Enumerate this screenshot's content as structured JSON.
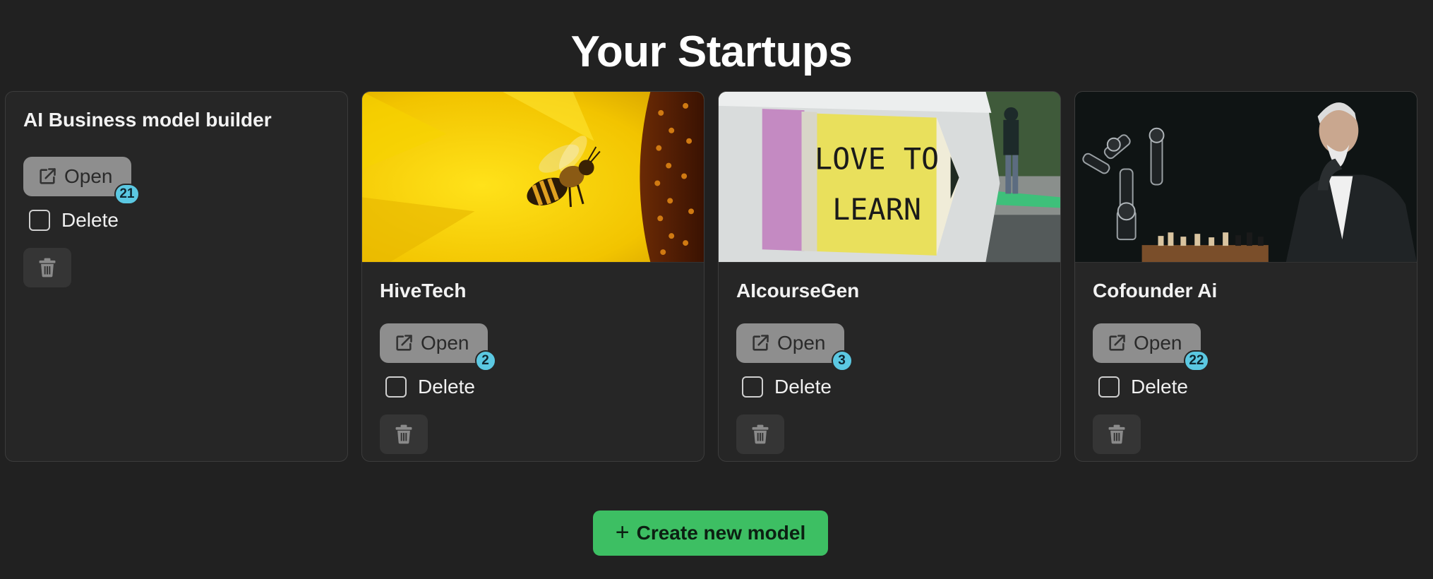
{
  "page": {
    "title": "Your Startups"
  },
  "colors": {
    "background": "#212121",
    "card": "#262626",
    "open_button": "#8e8e8e",
    "badge": "#5bc8e2",
    "create_button": "#3dbf63"
  },
  "cards": [
    {
      "title": "AI Business model builder",
      "open_label": "Open",
      "badge": "21",
      "delete_label": "Delete",
      "image": null
    },
    {
      "title": "HiveTech",
      "open_label": "Open",
      "badge": "2",
      "delete_label": "Delete",
      "image": "bee-on-sunflower"
    },
    {
      "title": "AIcourseGen",
      "open_label": "Open",
      "badge": "3",
      "delete_label": "Delete",
      "image": "love-to-learn-pencil-wall",
      "image_text": [
        "LOVE TO",
        "LEARN"
      ]
    },
    {
      "title": "Cofounder Ai",
      "open_label": "Open",
      "badge": "22",
      "delete_label": "Delete",
      "image": "robot-arm-chess-man"
    }
  ],
  "icons": {
    "open": "external-link-icon",
    "trash": "trash-icon",
    "create": "plus-icon"
  },
  "create_button": {
    "icon": "+",
    "label": "Create new model"
  }
}
